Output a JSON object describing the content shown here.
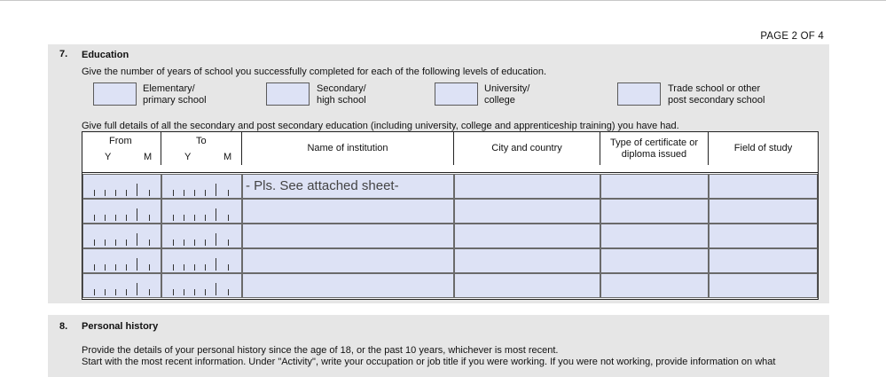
{
  "page_label": "PAGE 2 OF 4",
  "section7": {
    "number": "7.",
    "title": "Education",
    "instruction": "Give the number of years of school you successfully completed for each of the following levels of education.",
    "levels": [
      {
        "line1": "Elementary/",
        "line2": "primary school"
      },
      {
        "line1": "Secondary/",
        "line2": "high school"
      },
      {
        "line1": "University/",
        "line2": "college"
      },
      {
        "line1": "Trade school or other",
        "line2": "post secondary school"
      }
    ],
    "details_instruction": "Give full details of all the secondary and post secondary education (including university, college and apprenticeship training) you have had.",
    "table": {
      "from": "From",
      "to": "To",
      "y": "Y",
      "m": "M",
      "institution": "Name of institution",
      "city": "City and country",
      "certificate_line1": "Type of certificate or",
      "certificate_line2": "diploma issued",
      "field": "Field of study",
      "entry_text": "- Pls. See attached sheet-"
    }
  },
  "section8": {
    "number": "8.",
    "title": "Personal history",
    "line1": "Provide the details of your personal history since the age of 18, or the past 10 years, whichever is most recent.",
    "line2": "Start with the most recent information. Under \"Activity\", write your occupation or job title if you were working. If you were not working, provide information on what"
  },
  "colors": {
    "fill_blue": "#dde2f5",
    "section_gray": "#e6e6e6"
  }
}
